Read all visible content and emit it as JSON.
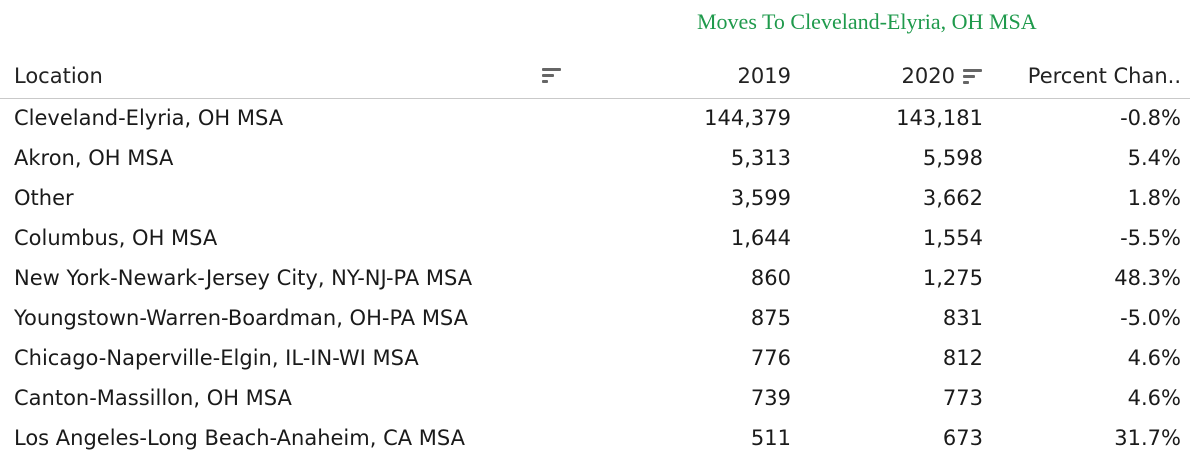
{
  "chart_data": {
    "type": "table",
    "title": "Moves To Cleveland-Elyria, OH MSA",
    "columns": [
      "Location",
      "2019",
      "2020",
      "Percent Chan.."
    ],
    "rows": [
      {
        "location": "Cleveland-Elyria, OH MSA",
        "y2019": "144,379",
        "y2020": "143,181",
        "pct": "-0.8%"
      },
      {
        "location": "Akron, OH MSA",
        "y2019": "5,313",
        "y2020": "5,598",
        "pct": "5.4%"
      },
      {
        "location": "Other",
        "y2019": "3,599",
        "y2020": "3,662",
        "pct": "1.8%"
      },
      {
        "location": "Columbus, OH MSA",
        "y2019": "1,644",
        "y2020": "1,554",
        "pct": "-5.5%"
      },
      {
        "location": "New York-Newark-Jersey City, NY-NJ-PA MSA",
        "y2019": "860",
        "y2020": "1,275",
        "pct": "48.3%"
      },
      {
        "location": "Youngstown-Warren-Boardman, OH-PA MSA",
        "y2019": "875",
        "y2020": "831",
        "pct": "-5.0%"
      },
      {
        "location": "Chicago-Naperville-Elgin, IL-IN-WI MSA",
        "y2019": "776",
        "y2020": "812",
        "pct": "4.6%"
      },
      {
        "location": "Canton-Massillon, OH MSA",
        "y2019": "739",
        "y2020": "773",
        "pct": "4.6%"
      },
      {
        "location": "Los Angeles-Long Beach-Anaheim, CA MSA",
        "y2019": "511",
        "y2020": "673",
        "pct": "31.7%"
      }
    ]
  },
  "colors": {
    "title": "#1f9a4c",
    "text": "#1a1a1a",
    "divider": "#c9c9c9",
    "icon": "#666666"
  },
  "icons": {
    "location_sort": "sort-lines-icon",
    "y2020_sort": "sort-lines-icon"
  }
}
